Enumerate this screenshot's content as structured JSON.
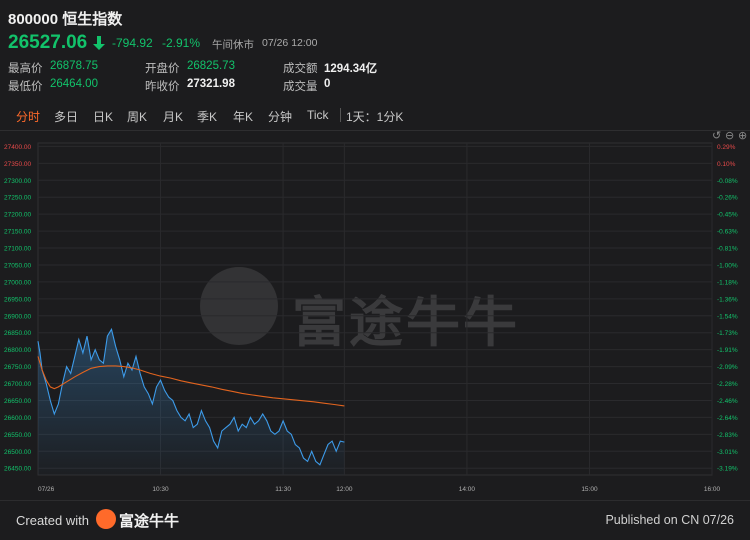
{
  "header": {
    "title": "800000 恒生指数",
    "price": "26527.06",
    "change": "-794.92",
    "change_pct": "-2.91%",
    "status": "午间休市",
    "datetime": "07/26 12:00",
    "stats": [
      {
        "label": "最高价",
        "value": "26878.75",
        "color": "green"
      },
      {
        "label": "开盘价",
        "value": "26825.73",
        "color": "green"
      },
      {
        "label": "成交额",
        "value": "1294.34亿",
        "color": "white"
      },
      {
        "label": "最低价",
        "value": "26464.00",
        "color": "green"
      },
      {
        "label": "昨收价",
        "value": "27321.98",
        "color": "white"
      },
      {
        "label": "成交量",
        "value": "0",
        "color": "white"
      }
    ]
  },
  "tabs": [
    {
      "label": "分时",
      "active": true
    },
    {
      "label": "多日",
      "active": false
    },
    {
      "label": "日K",
      "active": false
    },
    {
      "label": "周K",
      "active": false
    },
    {
      "label": "月K",
      "active": false
    },
    {
      "label": "季K",
      "active": false
    },
    {
      "label": "年K",
      "active": false
    },
    {
      "label": "分钟",
      "active": false
    },
    {
      "label": "Tick",
      "active": false
    }
  ],
  "period_selector": "1天：1分K",
  "watermark": "富途牛牛",
  "footer": {
    "created_with": "Created with",
    "brand": "富途牛牛",
    "published": "Published on CN 07/26"
  },
  "colors": {
    "up": "#e84a4a",
    "down": "#12c36b",
    "accent": "#ff6a2a",
    "price_line": "#3d9be9",
    "avg_line": "#e2641e"
  },
  "chart_data": {
    "type": "line",
    "title": "",
    "prev_close": 27321.98,
    "ylim": [
      26430,
      27410
    ],
    "xlim": [
      0,
      330
    ],
    "y_ticks_left": [
      "27400.00",
      "27350.00",
      "27300.00",
      "27250.00",
      "27200.00",
      "27150.00",
      "27100.00",
      "27050.00",
      "27000.00",
      "26950.00",
      "26900.00",
      "26850.00",
      "26800.00",
      "26750.00",
      "26700.00",
      "26650.00",
      "26600.00",
      "26550.00",
      "26500.00",
      "26450.00"
    ],
    "y_ticks_right": [
      "0.29%",
      "0.10%",
      "-0.08%",
      "-0.26%",
      "-0.45%",
      "-0.63%",
      "-0.81%",
      "-1.00%",
      "-1.18%",
      "-1.36%",
      "-1.54%",
      "-1.73%",
      "-1.91%",
      "-2.09%",
      "-2.28%",
      "-2.46%",
      "-2.64%",
      "-2.83%",
      "-3.01%",
      "-3.19%"
    ],
    "x_ticks": [
      {
        "minute": 0,
        "label": "07/26"
      },
      {
        "minute": 60,
        "label": "10:30"
      },
      {
        "minute": 120,
        "label": "11:30"
      },
      {
        "minute": 150,
        "label": "12:00"
      },
      {
        "minute": 210,
        "label": "14:00"
      },
      {
        "minute": 270,
        "label": "15:00"
      },
      {
        "minute": 330,
        "label": "16:00"
      }
    ],
    "series": [
      {
        "role": "price",
        "minutes": [
          0,
          1,
          2,
          4,
          6,
          8,
          10,
          12,
          14,
          16,
          18,
          20,
          22,
          24,
          26,
          28,
          30,
          32,
          34,
          36,
          38,
          40,
          42,
          44,
          46,
          48,
          50,
          52,
          54,
          56,
          58,
          60,
          62,
          64,
          66,
          68,
          70,
          72,
          74,
          76,
          78,
          80,
          82,
          84,
          86,
          88,
          90,
          92,
          94,
          96,
          98,
          100,
          102,
          104,
          106,
          108,
          110,
          112,
          114,
          116,
          118,
          120,
          122,
          124,
          126,
          128,
          130,
          132,
          134,
          136,
          138,
          140,
          142,
          144,
          146,
          148,
          150
        ],
        "values": [
          26825,
          26790,
          26740,
          26700,
          26650,
          26610,
          26640,
          26700,
          26750,
          26730,
          26780,
          26830,
          26790,
          26840,
          26770,
          26800,
          26770,
          26760,
          26840,
          26860,
          26810,
          26770,
          26720,
          26760,
          26740,
          26780,
          26730,
          26690,
          26670,
          26640,
          26690,
          26710,
          26680,
          26660,
          26650,
          26620,
          26600,
          26590,
          26610,
          26570,
          26580,
          26620,
          26590,
          26570,
          26530,
          26510,
          26560,
          26570,
          26580,
          26600,
          26560,
          26580,
          26570,
          26600,
          26580,
          26590,
          26610,
          26590,
          26560,
          26550,
          26560,
          26590,
          26560,
          26550,
          26520,
          26510,
          26480,
          26470,
          26500,
          26470,
          26460,
          26490,
          26520,
          26530,
          26500,
          26530,
          26527
        ]
      },
      {
        "role": "average",
        "minutes": [
          0,
          2,
          4,
          6,
          8,
          10,
          14,
          18,
          22,
          26,
          30,
          34,
          38,
          42,
          46,
          50,
          55,
          60,
          65,
          70,
          75,
          80,
          85,
          90,
          95,
          100,
          105,
          110,
          115,
          120,
          125,
          130,
          135,
          140,
          145,
          150
        ],
        "values": [
          26780,
          26740,
          26710,
          26690,
          26685,
          26690,
          26705,
          26720,
          26733,
          26745,
          26750,
          26752,
          26752,
          26750,
          26746,
          26740,
          26730,
          26722,
          26716,
          26708,
          26702,
          26696,
          26690,
          26683,
          26677,
          26671,
          26666,
          26662,
          26658,
          26655,
          26652,
          26649,
          26646,
          26642,
          26638,
          26634
        ]
      }
    ]
  }
}
